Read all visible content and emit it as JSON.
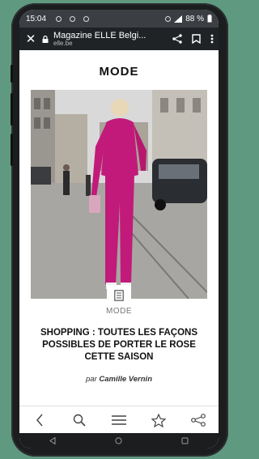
{
  "status_bar": {
    "time": "15:04",
    "battery": "88 %"
  },
  "browser": {
    "title": "Magazine ELLE Belgi...",
    "domain": "elle.be"
  },
  "page": {
    "section_title": "MODE",
    "category": "MODE",
    "headline": "SHOPPING : TOUTES LES FAÇONS POSSIBLES DE PORTER LE ROSE CETTE SAISON",
    "byline_prefix": "par",
    "author": "Camille Vernin"
  },
  "icons": {
    "close": "close-icon",
    "lock": "lock-icon",
    "share": "share-icon",
    "bookmark": "bookmark-icon",
    "menu": "more-vert-icon",
    "article": "article-icon",
    "back": "chevron-left-icon",
    "search": "search-icon",
    "hamburger": "hamburger-icon",
    "star": "star-icon",
    "share_bottom": "share-icon",
    "nav_back": "triangle-back-icon",
    "nav_home": "circle-home-icon",
    "nav_recents": "square-recents-icon"
  },
  "colors": {
    "background": "#5f9a80",
    "status_bar": "#3b3e42",
    "url_bar": "#202326",
    "outfit_accent": "#c21a7a"
  }
}
